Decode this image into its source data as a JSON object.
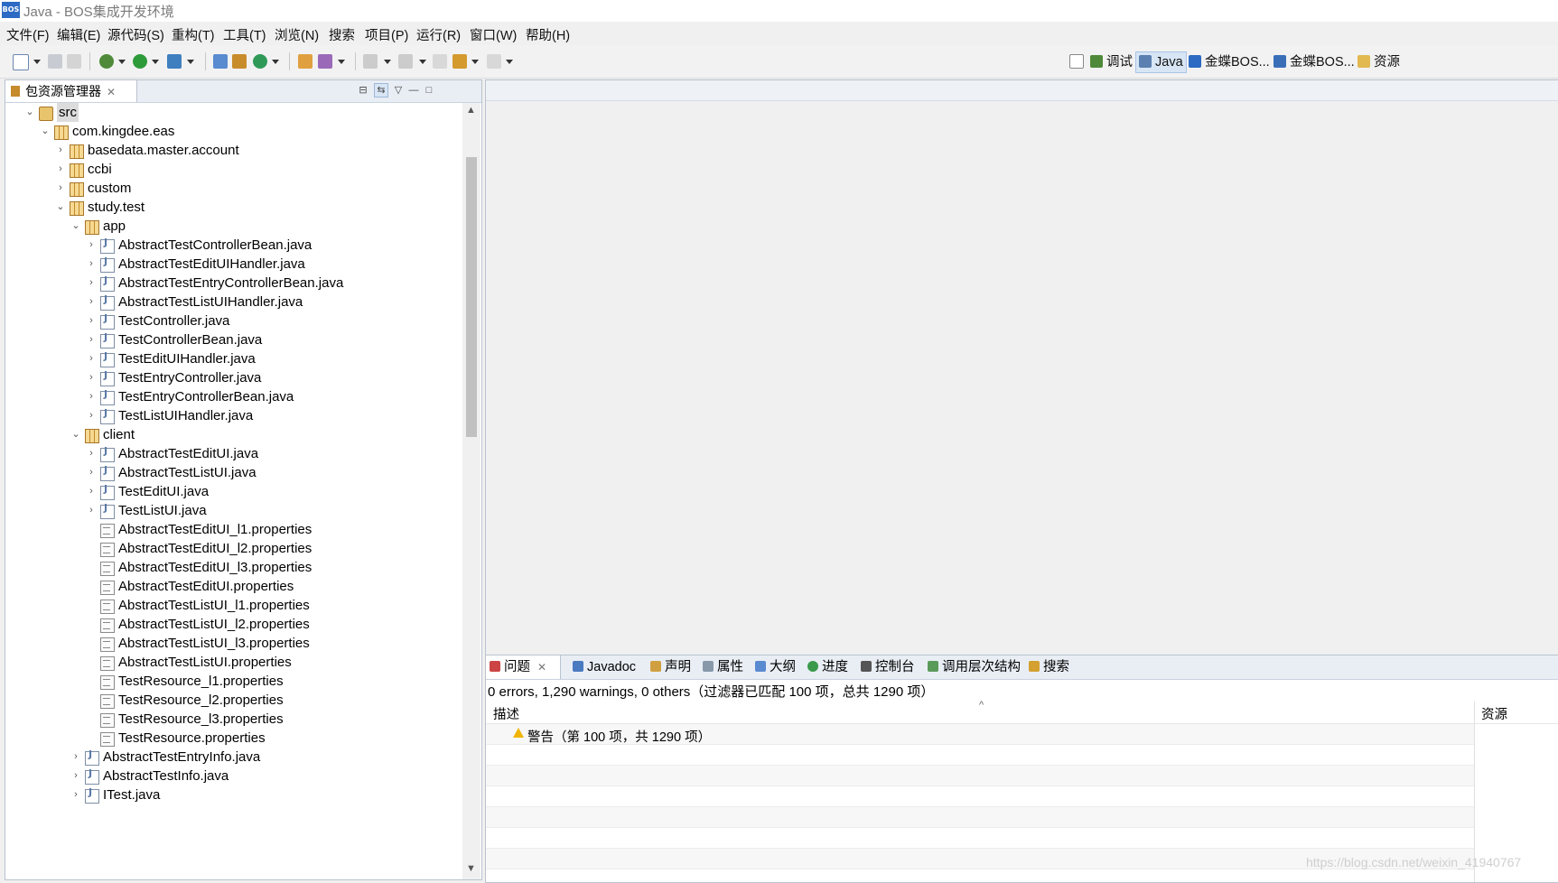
{
  "window": {
    "title": "Java  -  BOS集成开发环境",
    "app_icon_text": "BOS"
  },
  "menu": [
    "文件(F)",
    "编辑(E)",
    "源代码(S)",
    "重构(T)",
    "工具(T)",
    "浏览(N)",
    "搜索",
    "项目(P)",
    "运行(R)",
    "窗口(W)",
    "帮助(H)"
  ],
  "perspectives": [
    "调试",
    "Java",
    "金蝶BOS...",
    "金蝶BOS...",
    "资源"
  ],
  "package_explorer": {
    "tab_label": "包资源管理器",
    "tree": [
      {
        "label": "src",
        "depth": 0,
        "icon": "src",
        "expanded": true,
        "selected": true
      },
      {
        "label": "com.kingdee.eas",
        "depth": 1,
        "icon": "pkg",
        "expanded": true
      },
      {
        "label": "basedata.master.account",
        "depth": 2,
        "icon": "pkg",
        "expanded": false
      },
      {
        "label": "ccbi",
        "depth": 2,
        "icon": "pkg",
        "expanded": false
      },
      {
        "label": "custom",
        "depth": 2,
        "icon": "pkg",
        "expanded": false
      },
      {
        "label": "study.test",
        "depth": 2,
        "icon": "pkg",
        "expanded": true
      },
      {
        "label": "app",
        "depth": 3,
        "icon": "pkg",
        "expanded": true
      },
      {
        "label": "AbstractTestControllerBean.java",
        "depth": 4,
        "icon": "java",
        "expanded": false
      },
      {
        "label": "AbstractTestEditUIHandler.java",
        "depth": 4,
        "icon": "java",
        "expanded": false
      },
      {
        "label": "AbstractTestEntryControllerBean.java",
        "depth": 4,
        "icon": "java",
        "expanded": false
      },
      {
        "label": "AbstractTestListUIHandler.java",
        "depth": 4,
        "icon": "java",
        "expanded": false
      },
      {
        "label": "TestController.java",
        "depth": 4,
        "icon": "java",
        "expanded": false
      },
      {
        "label": "TestControllerBean.java",
        "depth": 4,
        "icon": "java",
        "expanded": false
      },
      {
        "label": "TestEditUIHandler.java",
        "depth": 4,
        "icon": "java",
        "expanded": false
      },
      {
        "label": "TestEntryController.java",
        "depth": 4,
        "icon": "java",
        "expanded": false
      },
      {
        "label": "TestEntryControllerBean.java",
        "depth": 4,
        "icon": "java",
        "expanded": false
      },
      {
        "label": "TestListUIHandler.java",
        "depth": 4,
        "icon": "java",
        "expanded": false
      },
      {
        "label": "client",
        "depth": 3,
        "icon": "pkg",
        "expanded": true
      },
      {
        "label": "AbstractTestEditUI.java",
        "depth": 4,
        "icon": "java",
        "expanded": false
      },
      {
        "label": "AbstractTestListUI.java",
        "depth": 4,
        "icon": "java",
        "expanded": false
      },
      {
        "label": "TestEditUI.java",
        "depth": 4,
        "icon": "java",
        "expanded": false
      },
      {
        "label": "TestListUI.java",
        "depth": 4,
        "icon": "java",
        "expanded": false
      },
      {
        "label": "AbstractTestEditUI_l1.properties",
        "depth": 4,
        "icon": "prop"
      },
      {
        "label": "AbstractTestEditUI_l2.properties",
        "depth": 4,
        "icon": "prop"
      },
      {
        "label": "AbstractTestEditUI_l3.properties",
        "depth": 4,
        "icon": "prop"
      },
      {
        "label": "AbstractTestEditUI.properties",
        "depth": 4,
        "icon": "prop"
      },
      {
        "label": "AbstractTestListUI_l1.properties",
        "depth": 4,
        "icon": "prop"
      },
      {
        "label": "AbstractTestListUI_l2.properties",
        "depth": 4,
        "icon": "prop"
      },
      {
        "label": "AbstractTestListUI_l3.properties",
        "depth": 4,
        "icon": "prop"
      },
      {
        "label": "AbstractTestListUI.properties",
        "depth": 4,
        "icon": "prop"
      },
      {
        "label": "TestResource_l1.properties",
        "depth": 4,
        "icon": "prop"
      },
      {
        "label": "TestResource_l2.properties",
        "depth": 4,
        "icon": "prop"
      },
      {
        "label": "TestResource_l3.properties",
        "depth": 4,
        "icon": "prop"
      },
      {
        "label": "TestResource.properties",
        "depth": 4,
        "icon": "prop"
      },
      {
        "label": "AbstractTestEntryInfo.java",
        "depth": 3,
        "icon": "java",
        "expanded": false
      },
      {
        "label": "AbstractTestInfo.java",
        "depth": 3,
        "icon": "java",
        "expanded": false
      },
      {
        "label": "ITest.java",
        "depth": 3,
        "icon": "java",
        "expanded": false
      }
    ]
  },
  "bottom_panel": {
    "tabs": [
      "问题",
      "Javadoc",
      "声明",
      "属性",
      "大纲",
      "进度",
      "控制台",
      "调用层次结构",
      "搜索"
    ],
    "summary": "0 errors, 1,290 warnings, 0 others（过滤器已匹配 100 项，总共 1290 项）",
    "columns": {
      "description": "描述",
      "resource": "资源"
    },
    "rows": [
      {
        "text": "警告（第 100 项，共 1290 项）",
        "type": "warning"
      }
    ]
  },
  "watermark": "https://blog.csdn.net/weixin_41940767",
  "colors": {
    "accent": "#2c6ac4",
    "warning": "#f0b400",
    "selection": "#d7e5f5"
  }
}
